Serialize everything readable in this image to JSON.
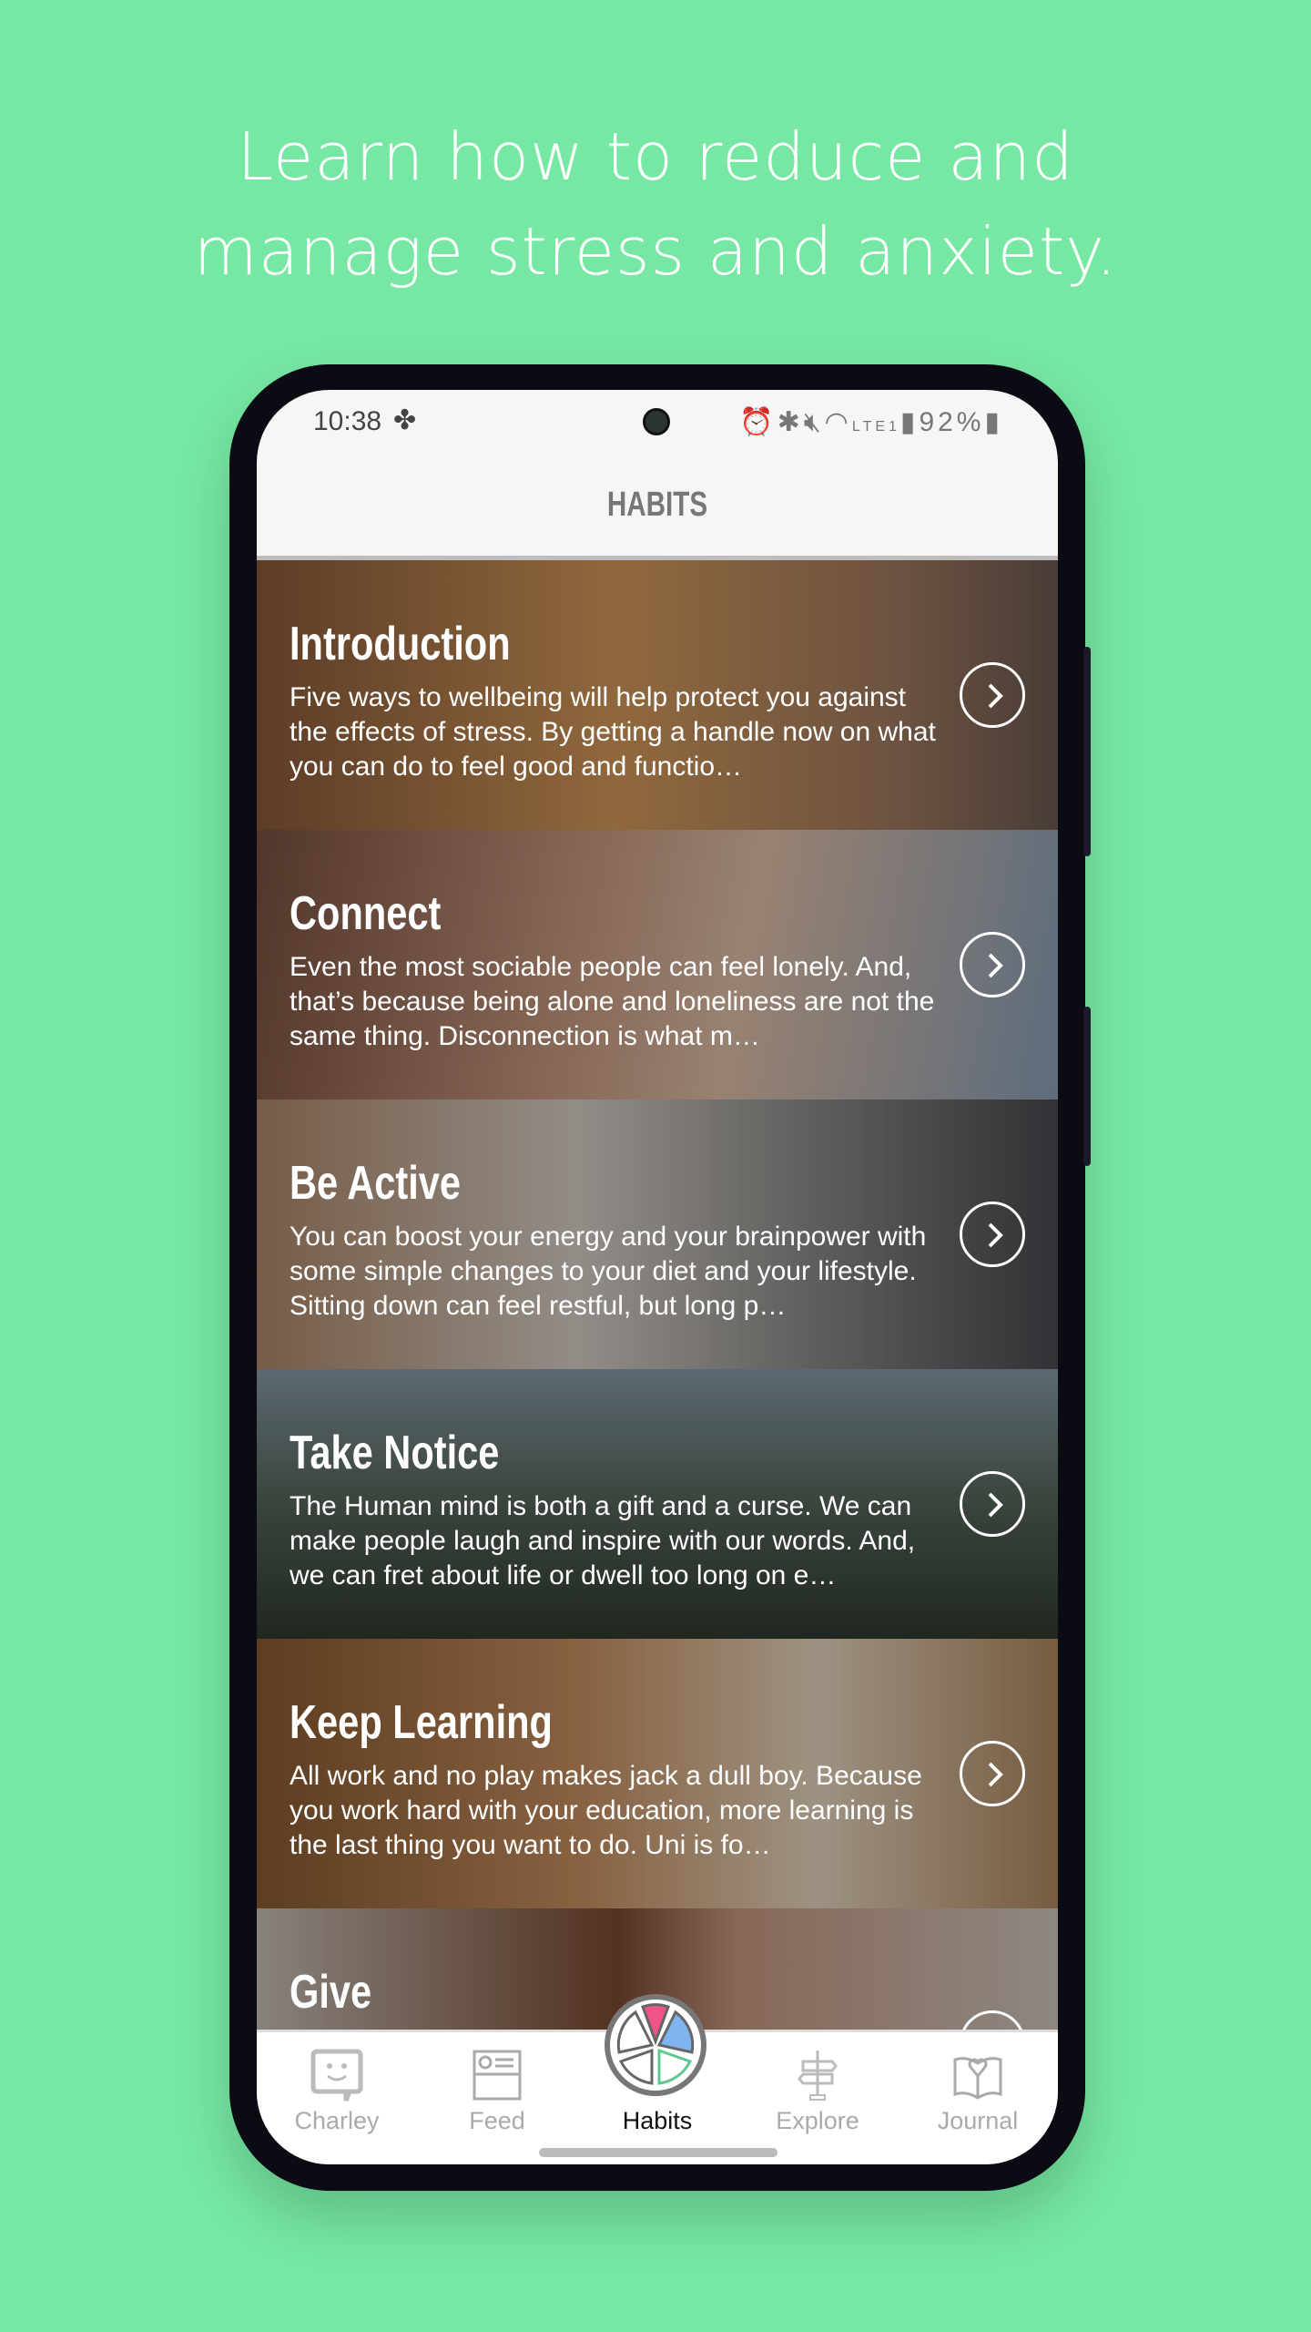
{
  "headline": [
    "Learn how to reduce and",
    "manage stress and anxiety."
  ],
  "status_bar": {
    "time": "10:38",
    "battery": "92%",
    "network": "LTE1"
  },
  "header": {
    "title": "HABITS"
  },
  "cards": [
    {
      "title": "Introduction",
      "description": "Five ways to wellbeing will help protect you against the effects of stress. By getting a handle now on what you can do to feel good and functio…",
      "bg": "linear-gradient(90deg,#8a5a3a,#d59a5a 45%,#a07a60 80%,#6c5a52)"
    },
    {
      "title": "Connect",
      "description": "Even the most sociable people can feel lonely. And, that’s because being alone and loneliness are not the same thing. Disconnection is what m…",
      "bg": "linear-gradient(100deg,#7a5040,#c99a80 40%,#e0c0a8 60%,#8aa0b8)"
    },
    {
      "title": "Be Active",
      "description": "You can boost your energy and your brainpower with some simple changes to your diet and your lifestyle. Sitting down can feel restful, but long p…",
      "bg": "linear-gradient(90deg,#b08868,#d8d0c8 40%,#8a8a88 70%,#4a4a50)"
    },
    {
      "title": "Take Notice",
      "description": "The Human mind is both a gift and a curse. We can make people laugh and inspire with our words. And, we can fret about life or dwell too long on e…",
      "bg": "linear-gradient(180deg,#8a9aa8,#5a6a60 45%,#2f3a30)"
    },
    {
      "title": "Keep Learning",
      "description": "All work and no play makes jack a dull boy. Because you work hard with your education, more learning is the last thing you want to do. Uni is fo…",
      "bg": "linear-gradient(90deg,#8a5a30,#c89060 40%,#e8d8c0 70%,#b08860)"
    },
    {
      "title": "Give",
      "description": "",
      "bg": "linear-gradient(90deg,#c8c0b8,#7a4a30 45%,#c89a80 60%,#d0c8c0)"
    }
  ],
  "nav": [
    {
      "label": "Charley",
      "icon": "chat-face-icon"
    },
    {
      "label": "Feed",
      "icon": "newspaper-icon"
    },
    {
      "label": "Habits",
      "icon": "habits-wheel-icon",
      "active": true
    },
    {
      "label": "Explore",
      "icon": "signpost-icon"
    },
    {
      "label": "Journal",
      "icon": "heart-book-icon"
    }
  ],
  "colors": {
    "background": "#76e8a3",
    "wheel_pink": "#f0558a",
    "wheel_blue": "#7fb4f0",
    "wheel_green": "#5cc890"
  }
}
